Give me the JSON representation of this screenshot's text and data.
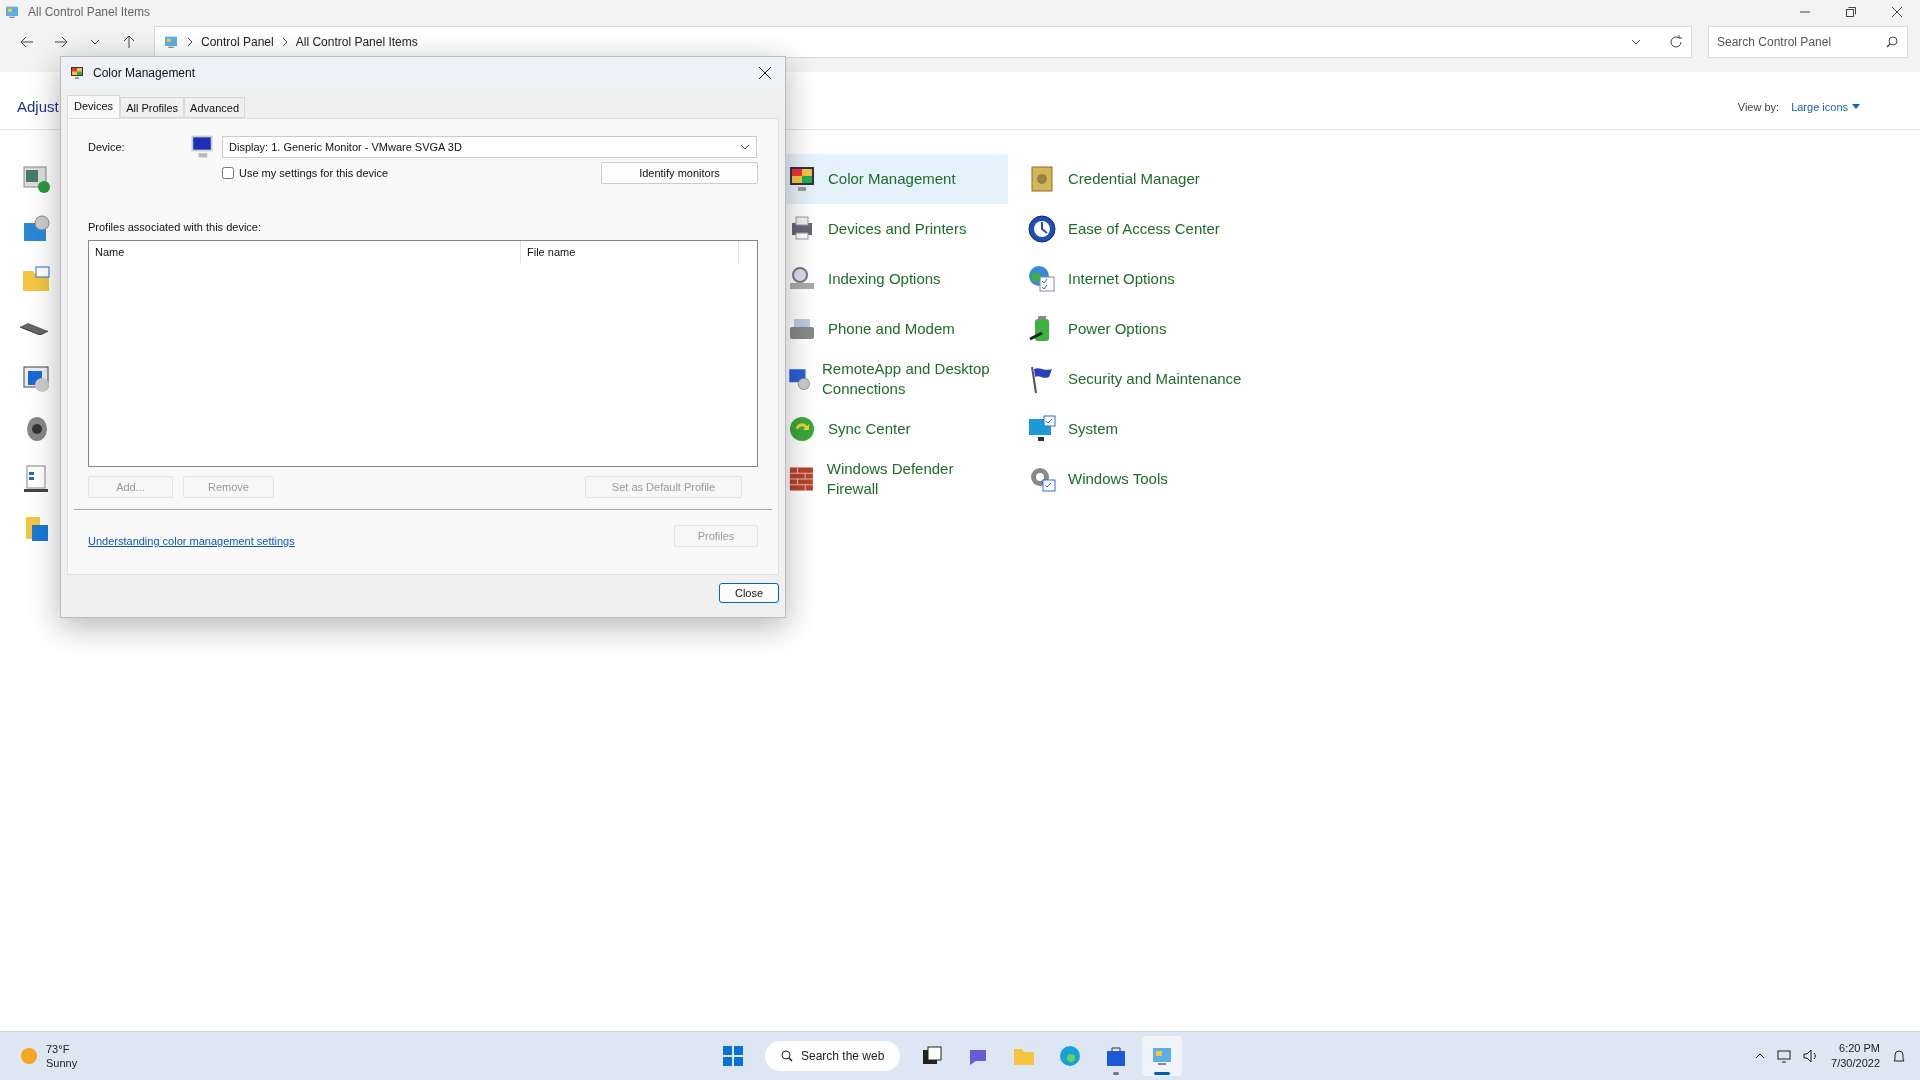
{
  "window": {
    "title": "All Control Panel Items"
  },
  "address": {
    "path": [
      "Control Panel",
      "All Control Panel Items"
    ]
  },
  "search": {
    "placeholder": "Search Control Panel"
  },
  "heading": "Adjust",
  "view_by": {
    "label": "View by:",
    "value": "Large icons"
  },
  "columns": [
    {
      "items": [
        {
          "label": "Color Management",
          "selected": true
        },
        {
          "label": "Devices and Printers",
          "selected": false
        },
        {
          "label": "Indexing Options",
          "selected": false
        },
        {
          "label": "Phone and Modem",
          "selected": false
        },
        {
          "label": "RemoteApp and Desktop Connections",
          "selected": false
        },
        {
          "label": "Sync Center",
          "selected": false
        },
        {
          "label": "Windows Defender Firewall",
          "selected": false
        }
      ]
    },
    {
      "items": [
        {
          "label": "Credential Manager",
          "selected": false
        },
        {
          "label": "Ease of Access Center",
          "selected": false
        },
        {
          "label": "Internet Options",
          "selected": false
        },
        {
          "label": "Power Options",
          "selected": false
        },
        {
          "label": "Security and Maintenance",
          "selected": false
        },
        {
          "label": "System",
          "selected": false
        },
        {
          "label": "Windows Tools",
          "selected": false
        }
      ]
    }
  ],
  "dialog": {
    "title": "Color Management",
    "tabs": [
      {
        "label": "Devices",
        "selected": true
      },
      {
        "label": "All Profiles",
        "selected": false
      },
      {
        "label": "Advanced",
        "selected": false
      }
    ],
    "device_label": "Device:",
    "device_value": "Display: 1. Generic Monitor - VMware SVGA 3D",
    "checkbox": {
      "label": "Use my settings for this device",
      "checked": false
    },
    "identify_button": "Identify monitors",
    "profiles_label": "Profiles associated with this device:",
    "table": {
      "columns": [
        "Name",
        "File name"
      ]
    },
    "buttons": [
      {
        "label": "Add...",
        "disabled": true
      },
      {
        "label": "Remove",
        "disabled": true
      },
      {
        "label": "Set as Default Profile",
        "disabled": true
      }
    ],
    "link": "Understanding color management settings",
    "profiles_button": {
      "label": "Profiles",
      "disabled": true
    },
    "close_button": "Close"
  },
  "taskbar": {
    "weather": {
      "temp": "73°F",
      "condition": "Sunny"
    },
    "search": "Search the web",
    "apps": [
      {
        "open": false,
        "selected": false
      },
      {
        "open": false,
        "selected": false
      },
      {
        "open": false,
        "selected": false
      },
      {
        "open": false,
        "selected": false
      },
      {
        "open": false,
        "selected": false
      },
      {
        "open": true,
        "selected": false
      },
      {
        "open": true,
        "selected": true
      }
    ],
    "clock": {
      "time": "6:20 PM",
      "date": "7/30/2022"
    }
  }
}
